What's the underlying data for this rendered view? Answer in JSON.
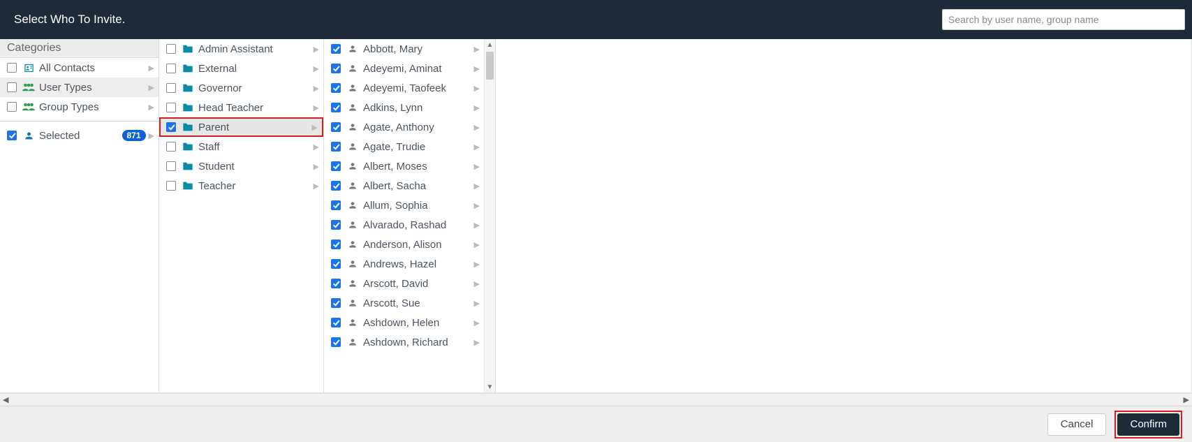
{
  "header": {
    "title": "Select Who To Invite.",
    "search_placeholder": "Search by user name, group name"
  },
  "categories": {
    "header": "Categories",
    "items": [
      {
        "label": "All Contacts",
        "icon": "contacts",
        "checked": false,
        "active": false
      },
      {
        "label": "User Types",
        "icon": "users",
        "checked": false,
        "active": true
      },
      {
        "label": "Group Types",
        "icon": "users",
        "checked": false,
        "active": false
      }
    ],
    "selected": {
      "label": "Selected",
      "count": "871",
      "checked": true,
      "icon": "person"
    }
  },
  "folders": [
    {
      "label": "Admin Assistant",
      "checked": false,
      "highlight": false
    },
    {
      "label": "External",
      "checked": false,
      "highlight": false
    },
    {
      "label": "Governor",
      "checked": false,
      "highlight": false
    },
    {
      "label": "Head Teacher",
      "checked": false,
      "highlight": false
    },
    {
      "label": "Parent",
      "checked": true,
      "highlight": true
    },
    {
      "label": "Staff",
      "checked": false,
      "highlight": false
    },
    {
      "label": "Student",
      "checked": false,
      "highlight": false
    },
    {
      "label": "Teacher",
      "checked": false,
      "highlight": false
    }
  ],
  "contacts": [
    {
      "label": "Abbott, Mary",
      "checked": true
    },
    {
      "label": "Adeyemi, Aminat",
      "checked": true
    },
    {
      "label": "Adeyemi, Taofeek",
      "checked": true
    },
    {
      "label": "Adkins, Lynn",
      "checked": true
    },
    {
      "label": "Agate, Anthony",
      "checked": true
    },
    {
      "label": "Agate, Trudie",
      "checked": true
    },
    {
      "label": "Albert, Moses",
      "checked": true
    },
    {
      "label": "Albert, Sacha",
      "checked": true
    },
    {
      "label": "Allum, Sophia",
      "checked": true
    },
    {
      "label": "Alvarado, Rashad",
      "checked": true
    },
    {
      "label": "Anderson, Alison",
      "checked": true
    },
    {
      "label": "Andrews, Hazel",
      "checked": true
    },
    {
      "label": "Arscott, David",
      "checked": true
    },
    {
      "label": "Arscott, Sue",
      "checked": true
    },
    {
      "label": "Ashdown, Helen",
      "checked": true
    },
    {
      "label": "Ashdown, Richard",
      "checked": true
    }
  ],
  "footer": {
    "cancel": "Cancel",
    "confirm": "Confirm"
  },
  "colors": {
    "header_bg": "#1e2a38",
    "accent": "#1a73e8",
    "folder": "#0a7aa6",
    "users_icon": "#2e9b4f",
    "highlight_border": "#d22020",
    "badge_bg": "#0b62d6"
  }
}
